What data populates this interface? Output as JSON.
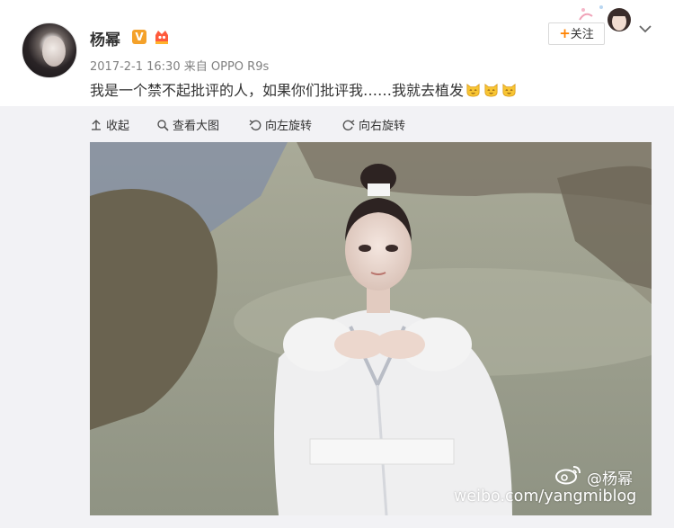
{
  "post": {
    "username": "杨幂",
    "vip_badge": "V",
    "timestamp": "2017-2-1 16:30",
    "source": "来自 OPPO R9s",
    "text": "我是一个禁不起批评的人，如果你们批评我……我就去植发",
    "emoji_count": 3,
    "emoji_name": "cat-emoji"
  },
  "follow_button": {
    "label": "关注",
    "plus": "+"
  },
  "toolbar": {
    "collapse": "收起",
    "view_large": "查看大图",
    "rotate_left": "向左旋转",
    "rotate_right": "向右旋转"
  },
  "watermark": {
    "user": "@杨幂",
    "url": "weibo.com/yangmiblog"
  },
  "icons": [
    "avatar",
    "vip-icon",
    "member-icon",
    "more-chevron-icon",
    "collapse-icon",
    "zoom-icon",
    "rotate-left-icon",
    "rotate-right-icon",
    "weibo-logo-icon"
  ],
  "colors": {
    "accent_orange": "#ff8200",
    "meta_gray": "#808080",
    "panel_bg": "#f2f2f5",
    "vip_gold": "#f4a12a"
  }
}
